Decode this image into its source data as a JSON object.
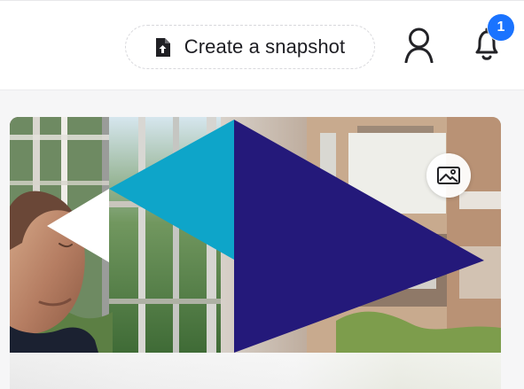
{
  "header": {
    "snapshot_button": {
      "label": "Create a snapshot",
      "icon": "document-upload-icon"
    },
    "user_button": {
      "icon": "user-profile-icon"
    },
    "notifications": {
      "icon": "bell-icon",
      "count": "1",
      "badge_color": "#1a73ff"
    }
  },
  "card": {
    "image_action": {
      "icon": "image-icon"
    },
    "hero_colors": {
      "navy": "#24197a",
      "cyan": "#0ea5c9",
      "white": "#ffffff"
    }
  }
}
